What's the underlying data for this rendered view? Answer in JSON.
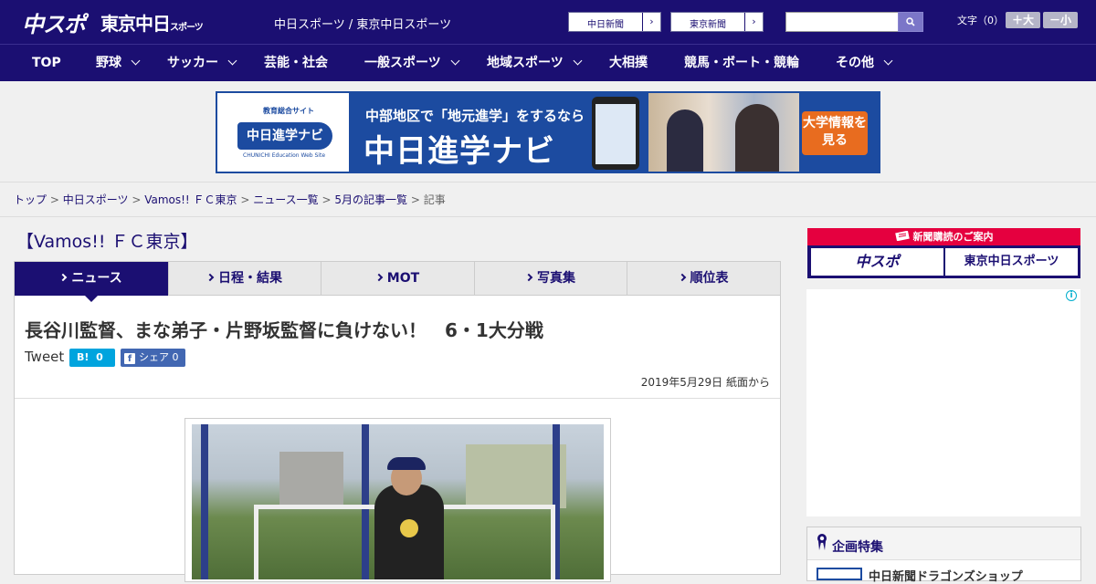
{
  "header": {
    "logo_chusupo": "中スポ",
    "logo_tokyo": "東京中日",
    "logo_tokyo_small": "スポーツ",
    "site_name": "中日スポーツ / 東京中日スポーツ",
    "paper_links": [
      "中日新聞",
      "東京新聞"
    ],
    "search_placeholder": "",
    "font_size_label": "文字（0）",
    "font_larger": "＋大",
    "font_smaller": "－小"
  },
  "nav": [
    {
      "label": "TOP",
      "dropdown": false
    },
    {
      "label": "野球",
      "dropdown": true
    },
    {
      "label": "サッカー",
      "dropdown": true
    },
    {
      "label": "芸能・社会",
      "dropdown": false
    },
    {
      "label": "一般スポーツ",
      "dropdown": true
    },
    {
      "label": "地域スポーツ",
      "dropdown": true
    },
    {
      "label": "大相撲",
      "dropdown": false
    },
    {
      "label": "競馬・ボート・競輪",
      "dropdown": false
    },
    {
      "label": "その他",
      "dropdown": true
    }
  ],
  "banner": {
    "logo_small": "教育総合サイト",
    "logo_main": "中日進学ナビ",
    "logo_tiny": "CHUNICHI Education Web Site",
    "line1": "中部地区で「地元進学」をするなら",
    "line2": "中日進学ナビ",
    "cta": "大学情報を見る"
  },
  "breadcrumb": [
    "トップ",
    "中日スポーツ",
    "Vamos!! ＦＣ東京",
    "ニュース一覧",
    "5月の記事一覧",
    "記事"
  ],
  "section_title": "【Vamos!! ＦＣ東京】",
  "tabs": [
    "ニュース",
    "日程・結果",
    "MOT",
    "写真集",
    "順位表"
  ],
  "active_tab": 0,
  "article": {
    "headline": "長谷川監督、まな弟子・片野坂監督に負けない！　6・1大分戦",
    "tweet": "Tweet",
    "hatena_label": "B!",
    "hatena_count": "0",
    "fb_label": "シェア",
    "fb_count": "0",
    "date": "2019年5月29日 紙面から"
  },
  "sidebar": {
    "subscribe_head": "新聞購読のご案内",
    "subscribe_logos": [
      "中スポ",
      "東京中日スポーツ"
    ],
    "ad_info_icon": "i",
    "feature_title": "企画特集",
    "feature_item": "中日新聞ドラゴンズショップ"
  },
  "colors": {
    "brand_navy": "#1b0f72",
    "accent_red": "#e5003f",
    "hatena_blue": "#00a4de",
    "facebook_blue": "#4267b2"
  }
}
